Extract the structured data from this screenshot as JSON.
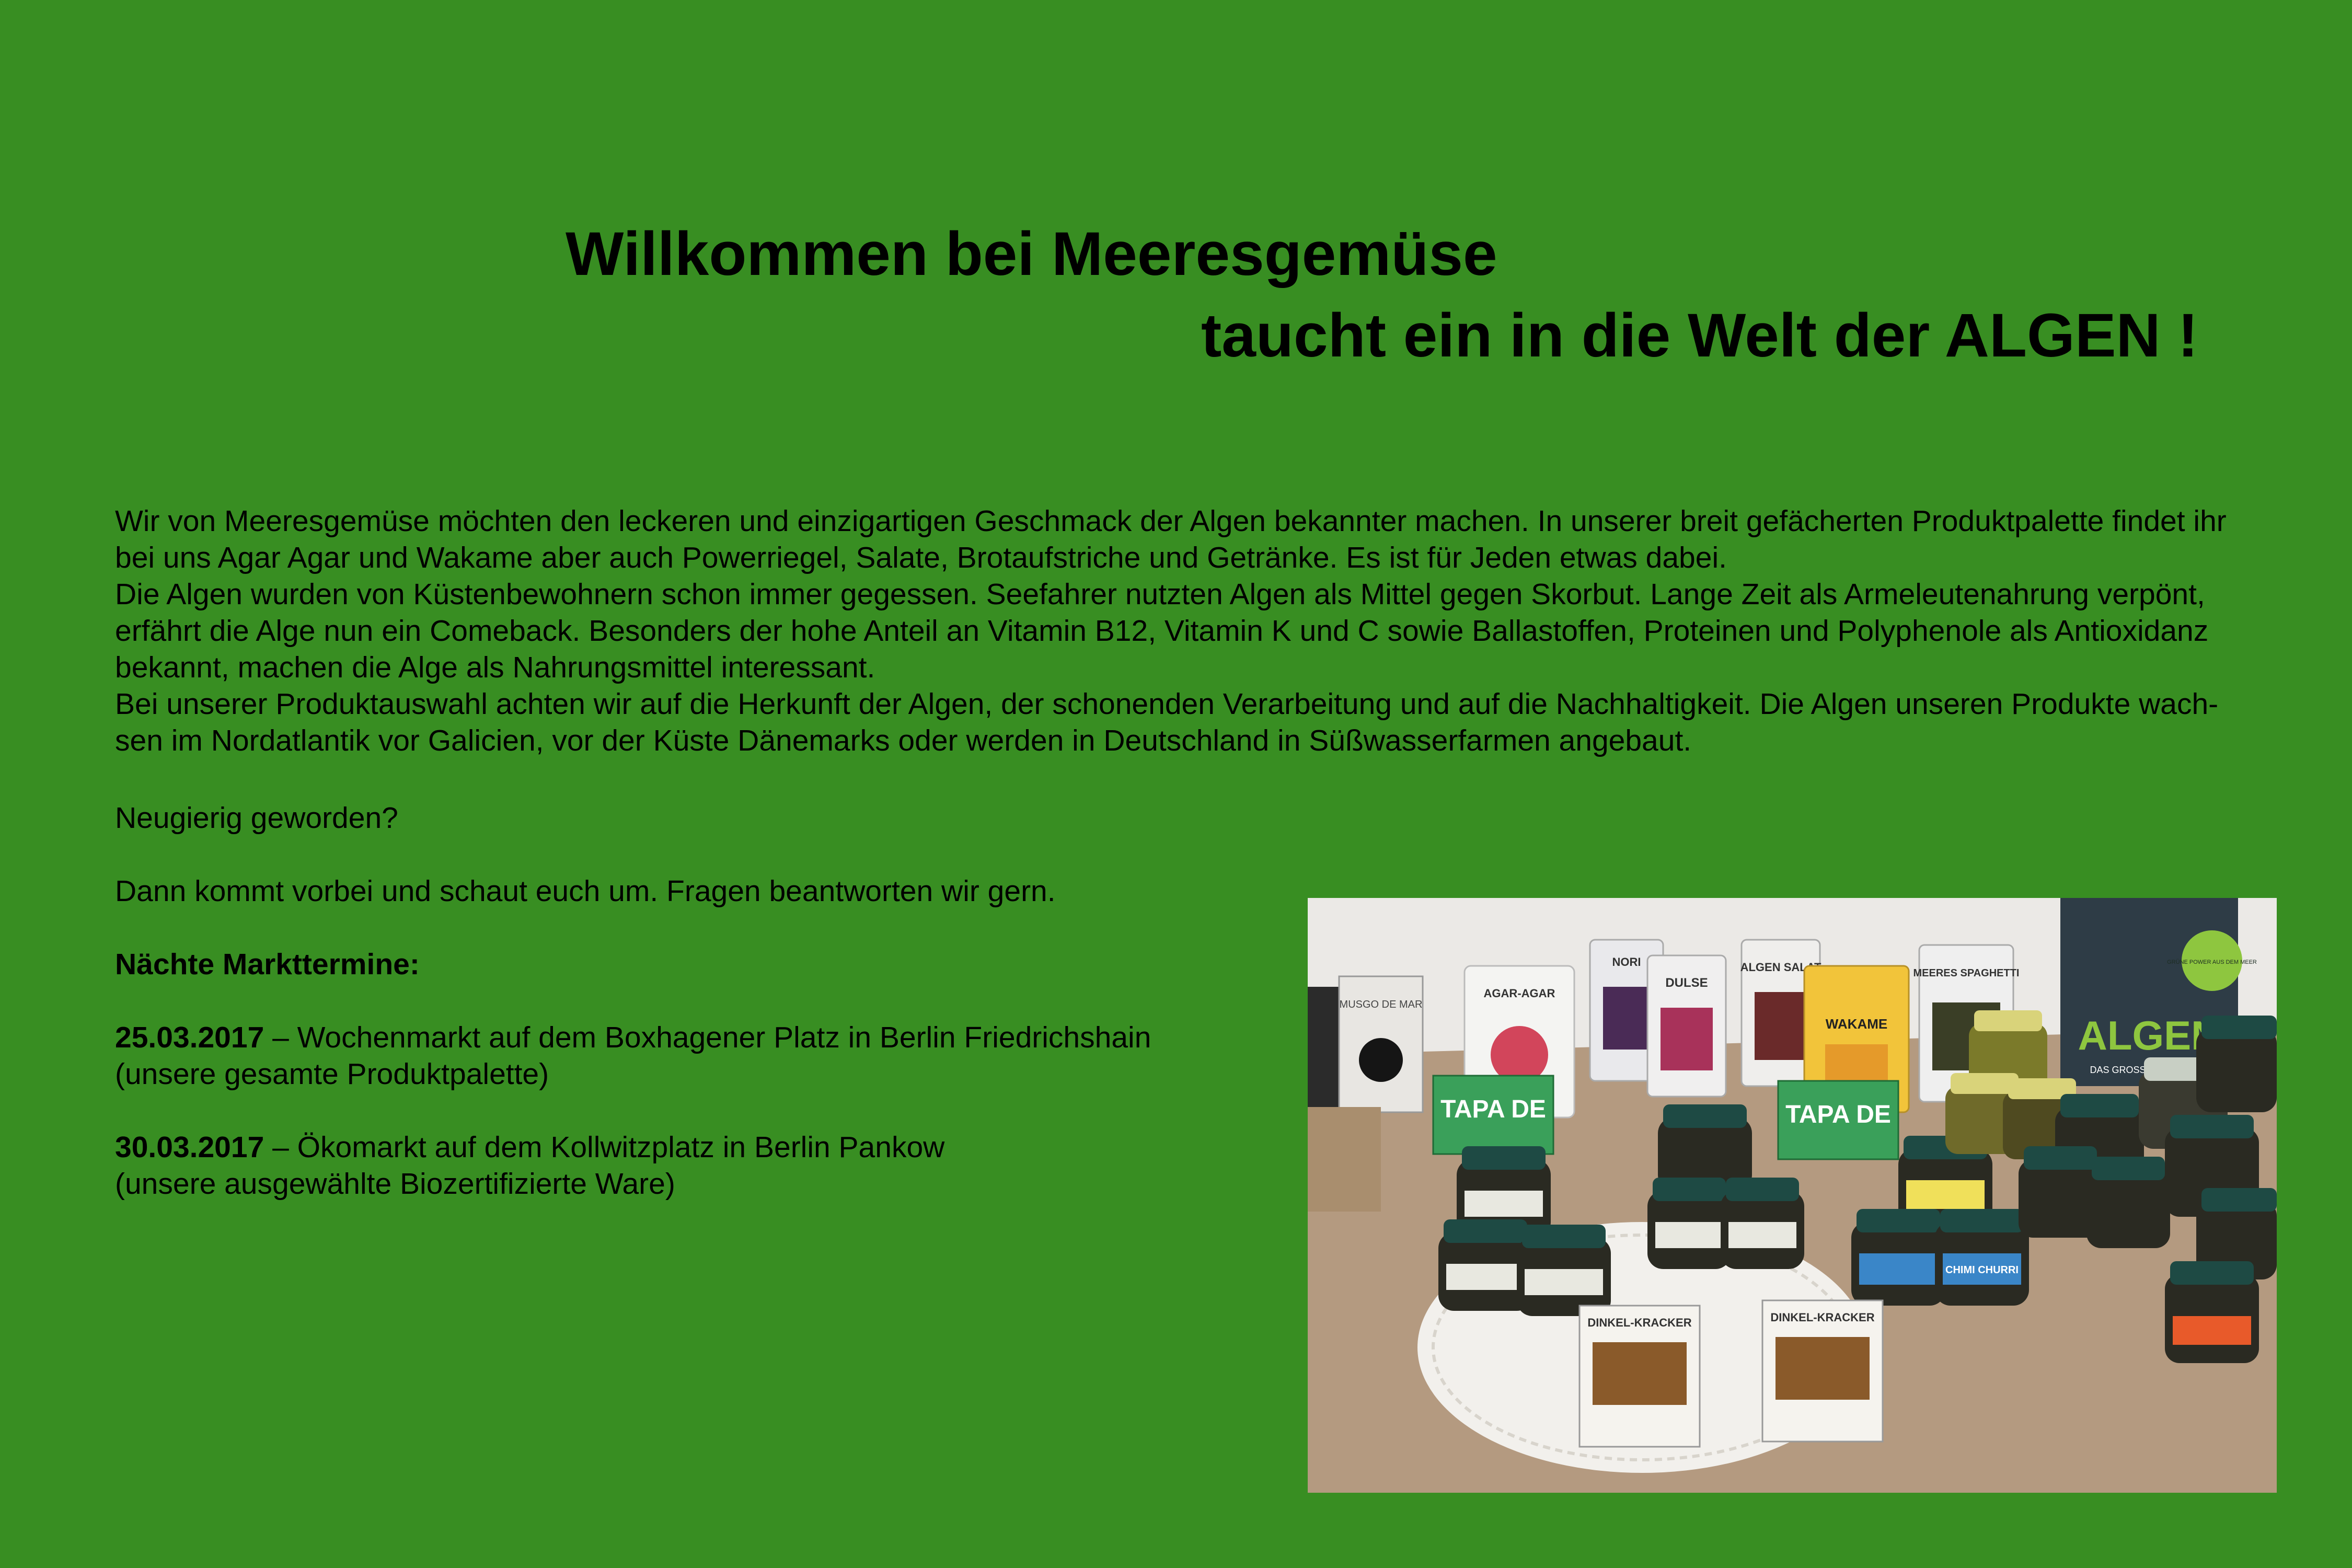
{
  "header": {
    "title_line1": "Willkommen bei Meeresgemüse",
    "title_line2": "taucht ein in die Welt der ALGEN !"
  },
  "intro": {
    "lines": [
      "Wir von Meeresgemüse möchten den leckeren und einzigartigen Geschmack der Algen bekannter machen. In unserer breit gefächerten Produktpalette findet ihr",
      "bei uns Agar Agar und Wakame aber auch Powerriegel, Salate, Brotaufstriche und Getränke. Es ist für Jeden etwas dabei.",
      "Die Algen wurden von Küstenbewohnern schon immer gegessen. Seefahrer nutzten Algen als Mittel gegen Skorbut. Lange Zeit als Armeleutenahrung verpönt,",
      "erfährt die Alge nun ein Comeback. Besonders der hohe Anteil an Vitamin B12, Vitamin K und C sowie Ballastoffen, Proteinen und Polyphenole als Antioxidanz",
      "bekannt, machen die Alge als Nahrungsmittel interessant.",
      "Bei unserer Produktauswahl achten wir auf die Herkunft der Algen, der schonenden Verarbeitung und auf die Nachhaltigkeit. Die Algen unseren Produkte wach-",
      "sen im Nordatlantik vor Galicien, vor der Küste Dänemarks oder werden in Deutschland in Süßwasserfarmen angebaut."
    ]
  },
  "cta": {
    "question": "Neugierig geworden?",
    "invite": "Dann kommt vorbei und schaut euch um. Fragen beantworten wir gern."
  },
  "market": {
    "heading": "Nächte Markttermine:",
    "events": [
      {
        "date": "25.03.2017",
        "text": " – Wochenmarkt auf dem Boxhagener Platz in Berlin Friedrichshain",
        "note": " (unsere gesamte Produktpalette)"
      },
      {
        "date": "30.03.2017",
        "text": " – Ökomarkt auf dem Kollwitzplatz in Berlin Pankow",
        "note": "(unsere ausgewählte Biozertifizierte Ware)"
      }
    ]
  },
  "photo": {
    "labels": {
      "book_title": "ALGEN",
      "book_subtitle": "DAS GROSSE KOCHBUCH",
      "book_badge": "GRÜNE POWER AUS DEM MEER",
      "pack_agar": "AGAR-AGAR",
      "pack_nori": "NORI",
      "pack_dulse": "DULSE",
      "pack_salat": "ALGEN SALAT",
      "pack_wakame": "WAKAME",
      "pack_spaghetti": "MEERES SPAGHETTI",
      "pack_musgo": "MUSGO DE MAR",
      "tapa1": "TAPA DE",
      "tapa2": "TAPA DE",
      "cracker1": "DINKEL-KRACKER",
      "cracker2": "DINKEL-KRACKER",
      "jar_chimi": "CHIMI CHURRI"
    },
    "colors": {
      "background": "#388e22",
      "wall": "#ebe9e6",
      "table": "#b49a80",
      "doily": "#f2f0ec",
      "jar_body": "#2a2a22",
      "jar_lid_dark": "#1e4a44",
      "jar_lid_light": "#7fb46f",
      "book": "#2e3c46",
      "tapa_green": "#3aa05a",
      "wakame_yellow": "#f2c43a"
    }
  }
}
